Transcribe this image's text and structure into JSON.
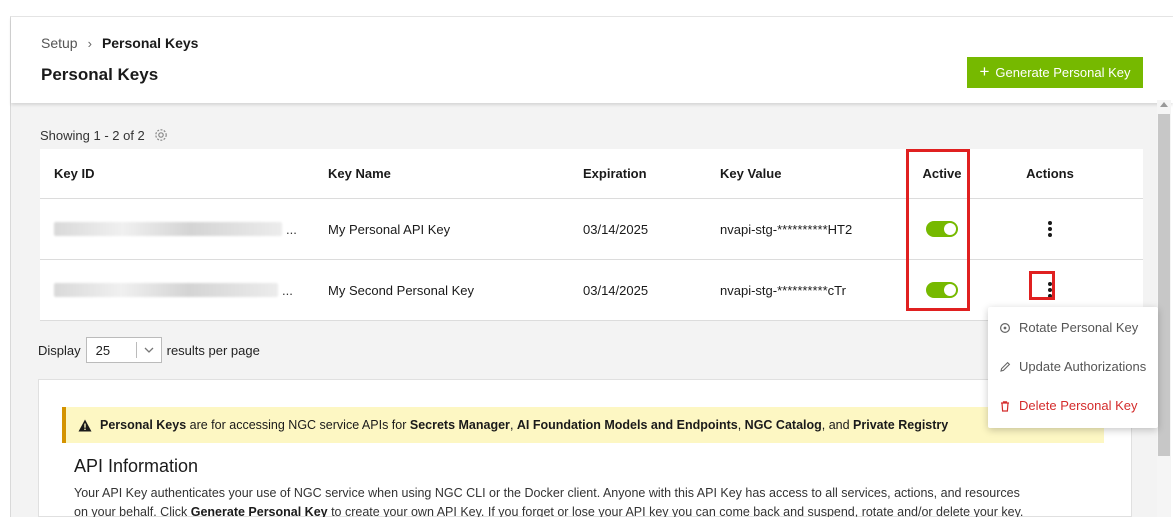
{
  "breadcrumb": {
    "root": "Setup",
    "separator": "›",
    "current": "Personal Keys"
  },
  "page_title": "Personal Keys",
  "generate_button": {
    "icon": "plus-icon",
    "label": "Generate Personal Key"
  },
  "showing": "Showing 1 - 2 of 2",
  "table": {
    "headers": {
      "key_id": "Key ID",
      "key_name": "Key Name",
      "expiration": "Expiration",
      "key_value": "Key Value",
      "active": "Active",
      "actions": "Actions"
    },
    "rows": [
      {
        "key_id_suffix": "...",
        "key_name": "My Personal API Key",
        "expiration": "03/14/2025",
        "key_value": "nvapi-stg-**********HT2",
        "active": true
      },
      {
        "key_id_suffix": "...",
        "key_name": "My Second Personal Key",
        "expiration": "03/14/2025",
        "key_value": "nvapi-stg-**********cTr",
        "active": true
      }
    ]
  },
  "pagination": {
    "display_label": "Display",
    "page_size": "25",
    "suffix": "results per page"
  },
  "actions_menu": {
    "rotate": "Rotate Personal Key",
    "update": "Update Authorizations",
    "delete": "Delete Personal Key"
  },
  "alert": {
    "lead": "Personal Keys",
    "text1": " are for accessing NGC service APIs for ",
    "s1": "Secrets Manager",
    "c1": ", ",
    "s2": "AI Foundation Models and Endpoints",
    "c2": ", ",
    "s3": "NGC Catalog",
    "c3": ", and ",
    "s4": "Private Registry"
  },
  "api_info": {
    "title": "API Information",
    "line1": "Your API Key authenticates your use of NGC service when using NGC CLI or the Docker client. Anyone with this API Key has access to all services, actions, and resources",
    "line2_a": "on your behalf. Click ",
    "line2_b": "Generate Personal Key",
    "line2_c": " to create your own API Key. If you forget or lose your API key you can come back and suspend, rotate and/or delete your key."
  },
  "colors": {
    "accent": "#76b900",
    "highlight": "#e02020",
    "delete": "#d42c2c",
    "alert_bg": "#fdf7c3",
    "alert_border": "#d49300"
  }
}
